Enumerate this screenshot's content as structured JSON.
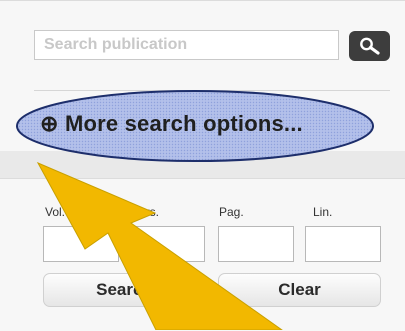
{
  "search": {
    "placeholder": "Search publication"
  },
  "more_options": {
    "label": "⊕ More search options..."
  },
  "fields": [
    {
      "label": "Vol."
    },
    {
      "label": "Pars."
    },
    {
      "label": "Pag."
    },
    {
      "label": "Lin."
    }
  ],
  "buttons": {
    "search_label": "Search",
    "clear_label": "Clear"
  },
  "icons": {
    "search": "magnifier-icon",
    "more": "circle-plus-icon"
  },
  "colors": {
    "highlight_fill": "#aab8e6",
    "highlight_border": "#1d2e6b",
    "arrow": "#f2b800"
  }
}
